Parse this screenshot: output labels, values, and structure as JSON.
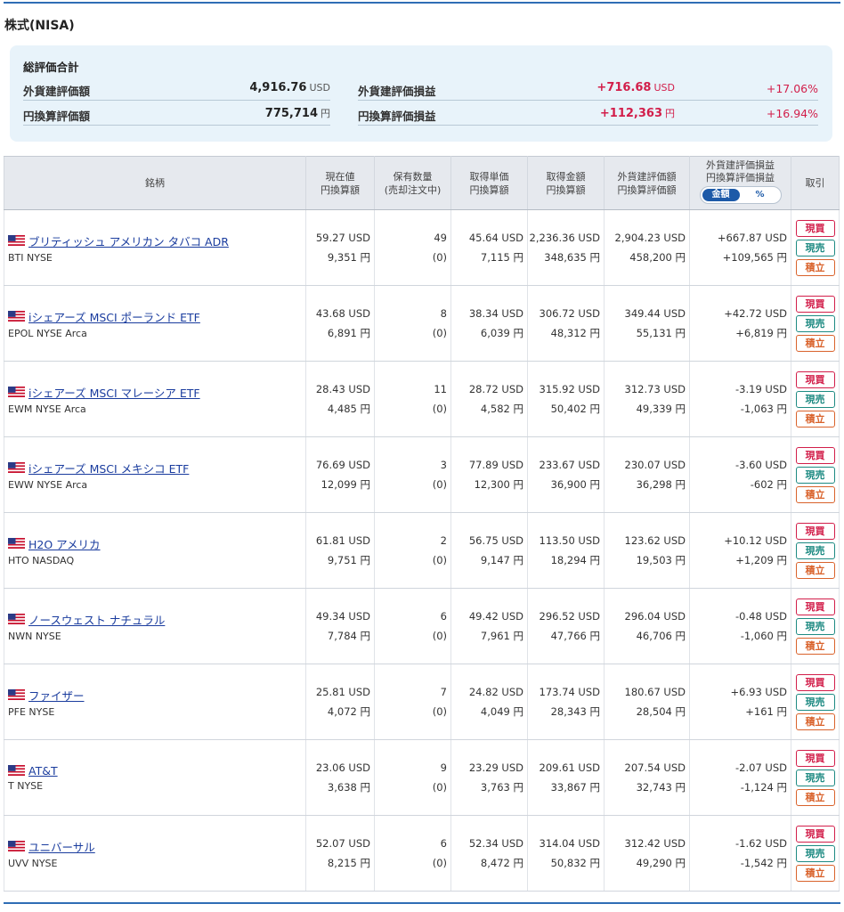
{
  "section_title": "株式(NISA)",
  "summary": {
    "title": "総評価合計",
    "foreign_value_label": "外貨建評価額",
    "foreign_value": "4,916.76",
    "foreign_value_unit": "USD",
    "yen_value_label": "円換算評価額",
    "yen_value": "775,714",
    "yen_value_unit": "円",
    "foreign_pl_label": "外貨建評価損益",
    "foreign_pl": "+716.68",
    "foreign_pl_unit": "USD",
    "foreign_pl_pct": "+17.06%",
    "yen_pl_label": "円換算評価損益",
    "yen_pl": "+112,363",
    "yen_pl_unit": "円",
    "yen_pl_pct": "+16.94%"
  },
  "table": {
    "headers": {
      "name": "銘柄",
      "price_1": "現在値",
      "price_2": "円換算額",
      "qty_1": "保有数量",
      "qty_2": "(売却注文中)",
      "cost_1": "取得単価",
      "cost_2": "円換算額",
      "amount_1": "取得金額",
      "amount_2": "円換算額",
      "value_1": "外貨建評価額",
      "value_2": "円換算評価額",
      "pl_1": "外貨建評価損益",
      "pl_2": "円換算評価損益",
      "toggle_amount": "金額",
      "toggle_pct": "%",
      "trade": "取引"
    },
    "buttons": {
      "buy": "現買",
      "sell": "現売",
      "save": "積立"
    },
    "flag_icon": "us-flag-icon",
    "rows": [
      {
        "name": "ブリティッシュ アメリカン タバコ ADR",
        "code": "BTI NYSE",
        "price": "59.27 USD",
        "price_yen": "9,351 円",
        "qty": "49",
        "qty_sell": "(0)",
        "unit_cost": "45.64 USD",
        "unit_cost_yen": "7,115 円",
        "cost": "2,236.36 USD",
        "cost_yen": "348,635 円",
        "value": "2,904.23 USD",
        "value_yen": "458,200 円",
        "pl": "+667.87 USD",
        "pl_yen": "+109,565 円",
        "sign": "pos"
      },
      {
        "name": "iシェアーズ MSCI ポーランド ETF",
        "code": "EPOL NYSE Arca",
        "price": "43.68 USD",
        "price_yen": "6,891 円",
        "qty": "8",
        "qty_sell": "(0)",
        "unit_cost": "38.34 USD",
        "unit_cost_yen": "6,039 円",
        "cost": "306.72 USD",
        "cost_yen": "48,312 円",
        "value": "349.44 USD",
        "value_yen": "55,131 円",
        "pl": "+42.72 USD",
        "pl_yen": "+6,819 円",
        "sign": "pos"
      },
      {
        "name": "iシェアーズ MSCI マレーシア ETF",
        "code": "EWM NYSE Arca",
        "price": "28.43 USD",
        "price_yen": "4,485 円",
        "qty": "11",
        "qty_sell": "(0)",
        "unit_cost": "28.72 USD",
        "unit_cost_yen": "4,582 円",
        "cost": "315.92 USD",
        "cost_yen": "50,402 円",
        "value": "312.73 USD",
        "value_yen": "49,339 円",
        "pl": "-3.19 USD",
        "pl_yen": "-1,063 円",
        "sign": "neg"
      },
      {
        "name": "iシェアーズ MSCI メキシコ ETF",
        "code": "EWW NYSE Arca",
        "price": "76.69 USD",
        "price_yen": "12,099 円",
        "qty": "3",
        "qty_sell": "(0)",
        "unit_cost": "77.89 USD",
        "unit_cost_yen": "12,300 円",
        "cost": "233.67 USD",
        "cost_yen": "36,900 円",
        "value": "230.07 USD",
        "value_yen": "36,298 円",
        "pl": "-3.60 USD",
        "pl_yen": "-602 円",
        "sign": "neg"
      },
      {
        "name": "H2O アメリカ",
        "code": "HTO NASDAQ",
        "price": "61.81 USD",
        "price_yen": "9,751 円",
        "qty": "2",
        "qty_sell": "(0)",
        "unit_cost": "56.75 USD",
        "unit_cost_yen": "9,147 円",
        "cost": "113.50 USD",
        "cost_yen": "18,294 円",
        "value": "123.62 USD",
        "value_yen": "19,503 円",
        "pl": "+10.12 USD",
        "pl_yen": "+1,209 円",
        "sign": "pos"
      },
      {
        "name": "ノースウェスト ナチュラル",
        "code": "NWN NYSE",
        "price": "49.34 USD",
        "price_yen": "7,784 円",
        "qty": "6",
        "qty_sell": "(0)",
        "unit_cost": "49.42 USD",
        "unit_cost_yen": "7,961 円",
        "cost": "296.52 USD",
        "cost_yen": "47,766 円",
        "value": "296.04 USD",
        "value_yen": "46,706 円",
        "pl": "-0.48 USD",
        "pl_yen": "-1,060 円",
        "sign": "neg"
      },
      {
        "name": "ファイザー",
        "code": "PFE NYSE",
        "price": "25.81 USD",
        "price_yen": "4,072 円",
        "qty": "7",
        "qty_sell": "(0)",
        "unit_cost": "24.82 USD",
        "unit_cost_yen": "4,049 円",
        "cost": "173.74 USD",
        "cost_yen": "28,343 円",
        "value": "180.67 USD",
        "value_yen": "28,504 円",
        "pl": "+6.93 USD",
        "pl_yen": "+161 円",
        "sign": "pos"
      },
      {
        "name": "AT&T",
        "code": "T NYSE",
        "price": "23.06 USD",
        "price_yen": "3,638 円",
        "qty": "9",
        "qty_sell": "(0)",
        "unit_cost": "23.29 USD",
        "unit_cost_yen": "3,763 円",
        "cost": "209.61 USD",
        "cost_yen": "33,867 円",
        "value": "207.54 USD",
        "value_yen": "32,743 円",
        "pl": "-2.07 USD",
        "pl_yen": "-1,124 円",
        "sign": "neg"
      },
      {
        "name": "ユニバーサル",
        "code": "UVV NYSE",
        "price": "52.07 USD",
        "price_yen": "8,215 円",
        "qty": "6",
        "qty_sell": "(0)",
        "unit_cost": "52.34 USD",
        "unit_cost_yen": "8,472 円",
        "cost": "314.04 USD",
        "cost_yen": "50,832 円",
        "value": "312.42 USD",
        "value_yen": "49,290 円",
        "pl": "-1.62 USD",
        "pl_yen": "-1,542 円",
        "sign": "neg"
      }
    ]
  },
  "colors": {
    "accent": "#2f6db5",
    "positive": "#d21e4a",
    "negative": "#1d8a82",
    "link": "#1a3c9e",
    "save": "#d9622b"
  }
}
